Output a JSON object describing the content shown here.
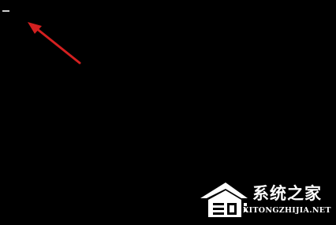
{
  "screen": {
    "background_color": "#000000",
    "cursor_color": "#d0d0d0"
  },
  "annotation": {
    "icon": "red-arrow-icon",
    "color": "#d42020",
    "points_to": "text-cursor"
  },
  "watermark": {
    "logo_icon": "house-logo-icon",
    "site_name": "系统之家",
    "site_url": "XITONGZHIJIA.NET"
  }
}
